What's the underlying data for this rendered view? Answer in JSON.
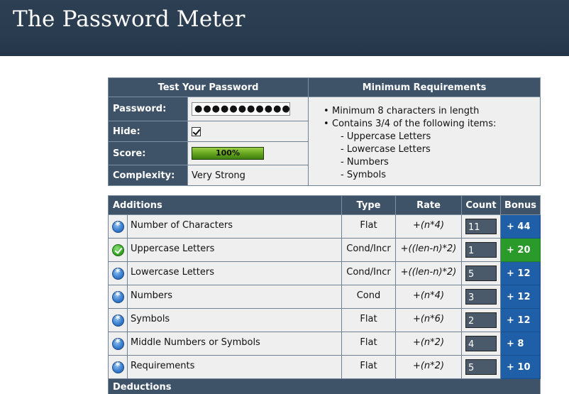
{
  "header": {
    "title": "The Password Meter"
  },
  "test": {
    "heading": "Test Your Password",
    "password_label": "Password:",
    "password_value": "●●●●●●●●●●●",
    "hide_label": "Hide:",
    "hide_checked": true,
    "score_label": "Score:",
    "score_text": "100%",
    "score_percent": 100,
    "complexity_label": "Complexity:",
    "complexity_value": "Very Strong"
  },
  "requirements": {
    "heading": "Minimum Requirements",
    "items": [
      "Minimum 8 characters in length",
      "Contains 3/4 of the following items:"
    ],
    "subitems": [
      "- Uppercase Letters",
      "- Lowercase Letters",
      "- Numbers",
      "- Symbols"
    ]
  },
  "additions": {
    "headers": {
      "name": "Additions",
      "type": "Type",
      "rate": "Rate",
      "count": "Count",
      "bonus": "Bonus"
    },
    "rows": [
      {
        "icon": "info-icon",
        "name": "Number of Characters",
        "type": "Flat",
        "rate": "+(n*4)",
        "count": "11",
        "bonus": "+ 44"
      },
      {
        "icon": "check-icon",
        "name": "Uppercase Letters",
        "type": "Cond/Incr",
        "rate": "+((len-n)*2)",
        "count": "1",
        "bonus": "+ 20"
      },
      {
        "icon": "info-icon",
        "name": "Lowercase Letters",
        "type": "Cond/Incr",
        "rate": "+((len-n)*2)",
        "count": "5",
        "bonus": "+ 12"
      },
      {
        "icon": "info-icon",
        "name": "Numbers",
        "type": "Cond",
        "rate": "+(n*4)",
        "count": "3",
        "bonus": "+ 12"
      },
      {
        "icon": "info-icon",
        "name": "Symbols",
        "type": "Flat",
        "rate": "+(n*6)",
        "count": "2",
        "bonus": "+ 12"
      },
      {
        "icon": "info-icon",
        "name": "Middle Numbers or Symbols",
        "type": "Flat",
        "rate": "+(n*2)",
        "count": "4",
        "bonus": "+ 8"
      },
      {
        "icon": "info-icon",
        "name": "Requirements",
        "type": "Flat",
        "rate": "+(n*2)",
        "count": "5",
        "bonus": "+ 10"
      }
    ]
  },
  "deductions": {
    "heading": "Deductions"
  },
  "colors": {
    "header_bg": "#2a3c4f",
    "table_header": "#3e5368",
    "bonus_blue": "#1f5fa8",
    "bonus_green": "#2a9a2a"
  }
}
